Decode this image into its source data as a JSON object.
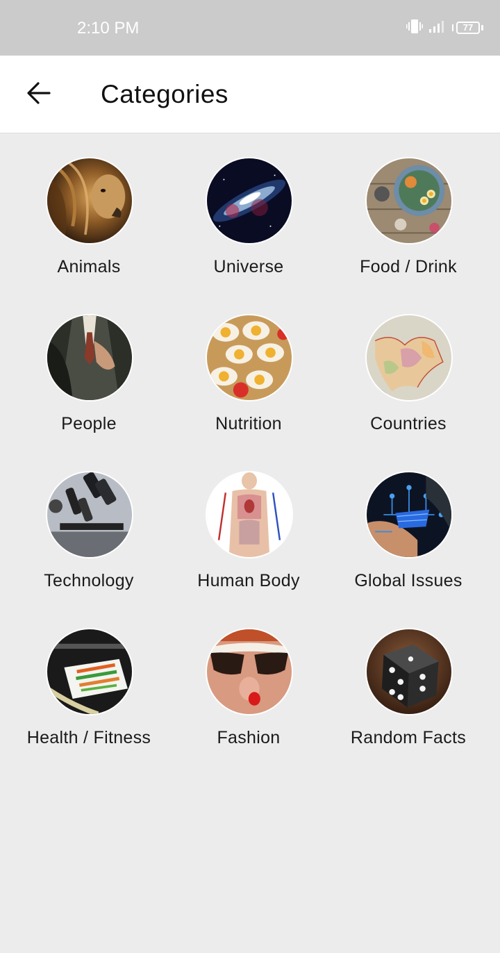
{
  "status_bar": {
    "time": "2:10 PM",
    "battery": "77",
    "icons": [
      "vibrate-icon",
      "signal-icon",
      "battery-icon"
    ]
  },
  "app_bar": {
    "title": "Categories",
    "back_icon": "arrow-left-icon"
  },
  "categories": [
    {
      "label": "Animals",
      "image": "lion-photo"
    },
    {
      "label": "Universe",
      "image": "galaxy-photo"
    },
    {
      "label": "Food / Drink",
      "image": "food-bowl-photo"
    },
    {
      "label": "People",
      "image": "man-in-suit-photo"
    },
    {
      "label": "Nutrition",
      "image": "eggs-photo"
    },
    {
      "label": "Countries",
      "image": "map-photo"
    },
    {
      "label": "Technology",
      "image": "microscope-photo"
    },
    {
      "label": "Human Body",
      "image": "anatomy-photo"
    },
    {
      "label": "Global Issues",
      "image": "digital-cart-photo"
    },
    {
      "label": "Health / Fitness",
      "image": "vegetables-photo"
    },
    {
      "label": "Fashion",
      "image": "sunglasses-photo"
    },
    {
      "label": "Random Facts",
      "image": "dice-photo"
    }
  ],
  "colors": {
    "status_bar": "#cbcbcb",
    "app_bar": "#ffffff",
    "background": "#ececec"
  }
}
